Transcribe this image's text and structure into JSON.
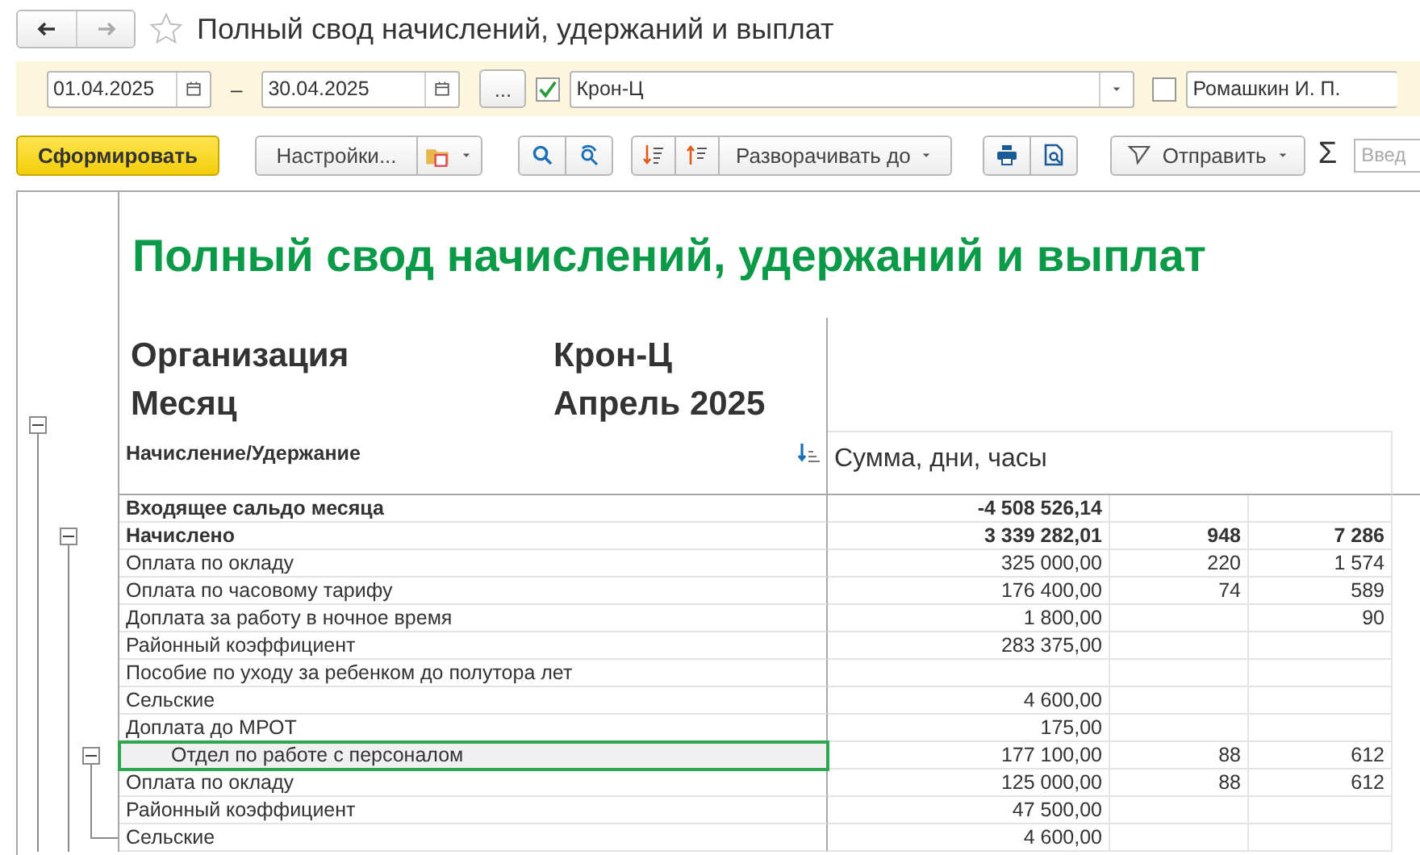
{
  "window": {
    "title": "Полный свод начислений, удержаний и выплат",
    "favorite": false
  },
  "filters": {
    "date_from": "01.04.2025",
    "separator": "–",
    "date_to": "30.04.2025",
    "more_button": "...",
    "organization_enabled": true,
    "organization": "Крон-Ц",
    "employee_enabled": false,
    "employee": "Ромашкин И. П."
  },
  "toolbar": {
    "generate": "Сформировать",
    "settings": "Настройки...",
    "expand_to": "Разворачивать до",
    "send": "Отправить",
    "sum": "Σ",
    "search_placeholder": "Введ"
  },
  "report": {
    "title": "Полный свод начислений, удержаний и выплат",
    "expanded": true,
    "header_fields": [
      {
        "label": "Организация",
        "value": "Крон-Ц"
      },
      {
        "label": "Месяц",
        "value": "Апрель 2025"
      }
    ],
    "name_header": "Начисление/Удержание",
    "value_header": "Сумма, дни, часы",
    "rows": [
      {
        "kind": "total",
        "name": "Входящее сальдо месяца",
        "amount": "-4 508 526,14"
      },
      {
        "kind": "total",
        "name": "Начислено",
        "amount": "3 339 282,01",
        "days": "948",
        "hours": "7 286",
        "expanded": true,
        "children": [
          {
            "kind": "item",
            "name": "Оплата по окладу",
            "amount": "325 000,00",
            "days": "220",
            "hours": "1 574"
          },
          {
            "kind": "item",
            "name": "Оплата по часовому тарифу",
            "amount": "176 400,00",
            "days": "74",
            "hours": "589"
          },
          {
            "kind": "item",
            "name": "Доплата за работу в ночное время",
            "amount": "1 800,00",
            "hours": "90"
          },
          {
            "kind": "item",
            "name": "Районный коэффициент",
            "amount": "283 375,00"
          },
          {
            "kind": "item",
            "name": "Пособие по уходу за ребенком до полутора лет"
          },
          {
            "kind": "item",
            "name": "Сельские",
            "amount": "4 600,00"
          },
          {
            "kind": "item",
            "name": "Доплата до МРОТ",
            "amount": "175,00"
          },
          {
            "kind": "subgroup",
            "name": "Отдел по работе с персоналом",
            "amount": "177 100,00",
            "days": "88",
            "hours": "612",
            "selected": true,
            "expanded": true,
            "children": [
              {
                "kind": "item",
                "name": "Оплата по окладу",
                "amount": "125 000,00",
                "days": "88",
                "hours": "612"
              },
              {
                "kind": "item",
                "name": "Районный коэффициент",
                "amount": "47 500,00"
              },
              {
                "kind": "item",
                "name": "Сельские",
                "amount": "4 600,00"
              }
            ]
          }
        ]
      }
    ]
  }
}
